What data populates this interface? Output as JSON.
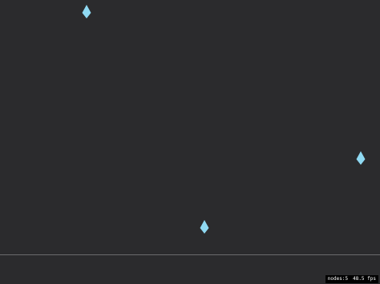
{
  "scene": {
    "background_color": "#2b2b2d",
    "drop_color": "#8fd9f2",
    "drops": [
      {
        "icon": "raindrop-icon"
      },
      {
        "icon": "raindrop-icon"
      },
      {
        "icon": "raindrop-icon"
      }
    ]
  },
  "hud": {
    "nodes_text": "nodes:5",
    "fps_text": "48.5 fps"
  }
}
